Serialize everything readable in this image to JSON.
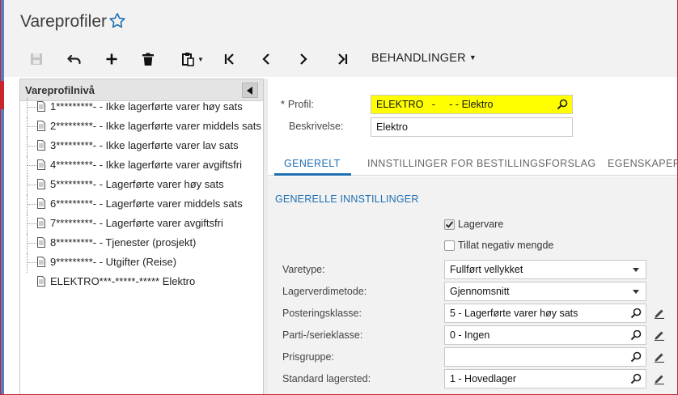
{
  "window": {
    "title": "Vareprofiler"
  },
  "toolbar": {
    "buttons": [
      {
        "name": "save",
        "icon": "save-icon",
        "enabled": false
      },
      {
        "name": "undo",
        "icon": "undo-icon"
      },
      {
        "name": "add",
        "icon": "plus-icon"
      },
      {
        "name": "delete",
        "icon": "trash-icon"
      },
      {
        "name": "copy-paste",
        "icon": "clipboard-icon"
      },
      {
        "name": "first",
        "icon": "first-icon"
      },
      {
        "name": "previous",
        "icon": "prev-icon"
      },
      {
        "name": "next",
        "icon": "next-icon"
      },
      {
        "name": "last",
        "icon": "last-icon"
      }
    ],
    "actions_label": "BEHANDLINGER"
  },
  "tree": {
    "header": "Vareprofilnivå",
    "items": [
      {
        "label": "1*********- - Ikke lagerførte varer høy sats"
      },
      {
        "label": "2*********- - Ikke lagerførte varer middels sats"
      },
      {
        "label": "3*********- - Ikke lagerførte varer lav sats"
      },
      {
        "label": "4*********- - Ikke lagerførte varer avgiftsfri"
      },
      {
        "label": "5*********- - Lagerførte varer høy sats"
      },
      {
        "label": "6*********- - Lagerførte varer middels sats"
      },
      {
        "label": "7*********- - Lagerførte varer avgiftsfri"
      },
      {
        "label": "8*********- - Tjenester (prosjekt)"
      },
      {
        "label": "9*********- - Utgifter (Reise)"
      },
      {
        "label": "ELEKTRO***-*****-***** Elektro"
      }
    ]
  },
  "form": {
    "profil_label": "Profil:",
    "profil_value": "ELEKTRO   -     - - Elektro",
    "beskrivelse_label": "Beskrivelse:",
    "beskrivelse_value": "Elektro"
  },
  "tabs": [
    {
      "label": "GENERELT",
      "active": true
    },
    {
      "label": "INNSTILLINGER FOR BESTILLINGSFORSLAG",
      "active": false
    },
    {
      "label": "EGENSKAPER",
      "active": false
    }
  ],
  "general": {
    "section_title": "GENERELLE INNSTILLINGER",
    "lagervare": {
      "label": "Lagervare",
      "checked": true
    },
    "tillat_negativ": {
      "label": "Tillat negativ mengde",
      "checked": false
    },
    "varetype": {
      "label": "Varetype:",
      "value": "Fullført vellykket"
    },
    "lagerverdimetode": {
      "label": "Lagerverdimetode:",
      "value": "Gjennomsnitt"
    },
    "posteringsklasse": {
      "label": "Posteringsklasse:",
      "value": "5 - Lagerførte varer høy sats"
    },
    "parti_serieklasse": {
      "label": "Parti-/serieklasse:",
      "value": "0 - Ingen"
    },
    "prisgruppe": {
      "label": "Prisgruppe:",
      "value": ""
    },
    "standard_lagersted": {
      "label": "Standard lagersted:",
      "value": "1 - Hovedlager"
    }
  },
  "colors": {
    "accent_blue": "#1f6fb2",
    "highlight_yellow": "#ffff00",
    "frame_red": "#c8262c"
  }
}
